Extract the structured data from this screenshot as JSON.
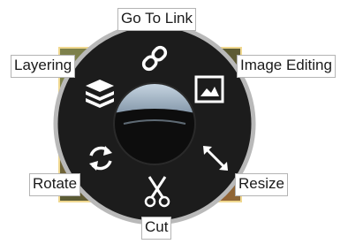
{
  "menu": {
    "items": {
      "go_to_link": {
        "label": "Go To Link",
        "icon": "link-icon"
      },
      "layering": {
        "label": "Layering",
        "icon": "layers-icon"
      },
      "image_editing": {
        "label": "Image Editing",
        "icon": "image-icon"
      },
      "rotate": {
        "label": "Rotate",
        "icon": "rotate-icon"
      },
      "resize": {
        "label": "Resize",
        "icon": "resize-icon"
      },
      "cut": {
        "label": "Cut",
        "icon": "scissors-icon"
      }
    }
  },
  "colors": {
    "ring": "#1c1c1c",
    "ring_border": "#b9b9b9",
    "icon": "#ffffff",
    "label_border": "#b4b4b4"
  }
}
